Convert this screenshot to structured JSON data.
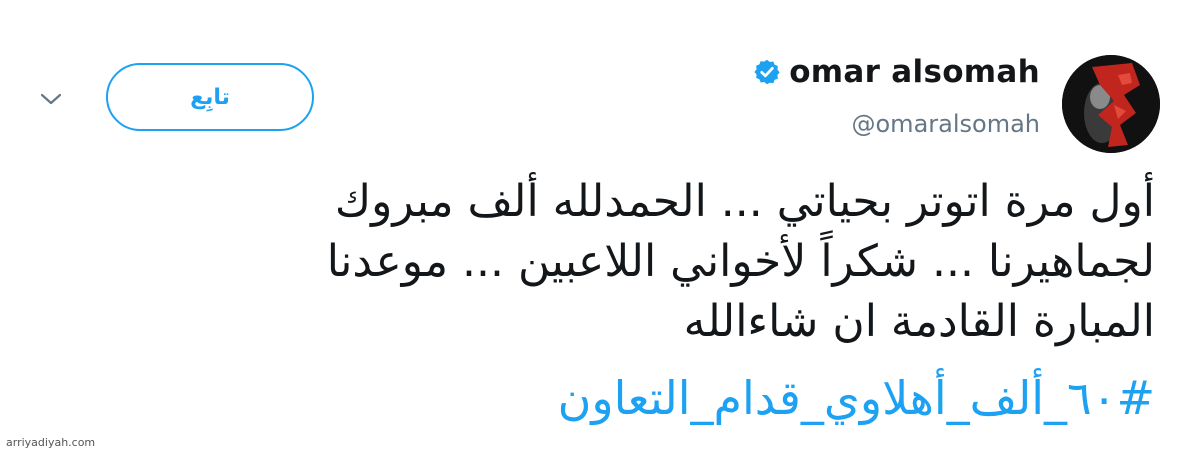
{
  "tweet": {
    "author": {
      "display_name": "omar alsomah",
      "handle": "@omaralsomah",
      "verified": true,
      "avatar_icon": "avatar-image"
    },
    "follow_label": "تابِع",
    "menu_icon": "chevron-down-icon",
    "text_lines": [
      "أول مرة اتوتر بحياتي ... الحمدلله ألف مبروك",
      "لجماهيرنا ... شكراً لأخواني اللاعبين ... موعدنا",
      "المبارة القادمة ان شاءالله"
    ],
    "hashtag": "#٦٠_ألف_أهلاوي_قدام_التعاون"
  },
  "watermark": "arriyadiyah.com",
  "colors": {
    "accent": "#1da1f2",
    "text": "#14171a",
    "secondary": "#657786"
  }
}
